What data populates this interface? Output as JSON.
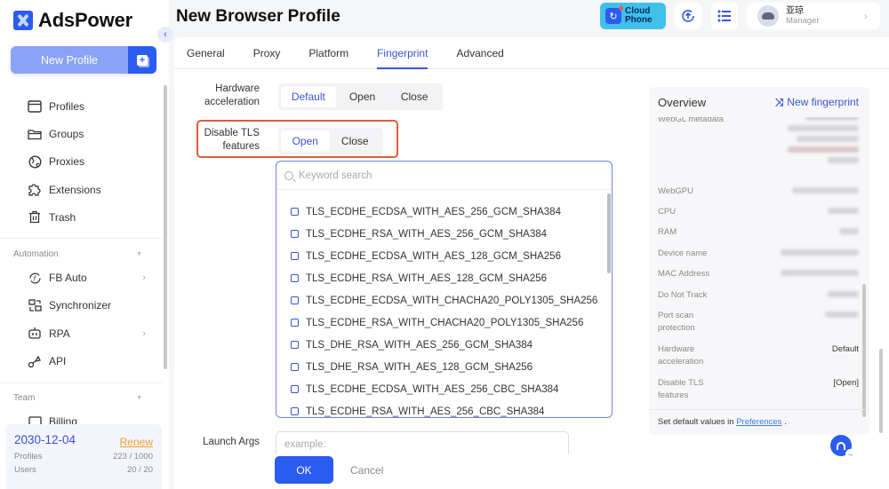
{
  "app": {
    "name": "AdsPower"
  },
  "sidebar": {
    "new_profile_label": "New Profile",
    "items": [
      {
        "label": "Profiles",
        "icon": "browser-window-icon"
      },
      {
        "label": "Groups",
        "icon": "folder-icon"
      },
      {
        "label": "Proxies",
        "icon": "globe-icon"
      },
      {
        "label": "Extensions",
        "icon": "puzzle-icon"
      },
      {
        "label": "Trash",
        "icon": "trash-icon"
      }
    ],
    "automation": {
      "title": "Automation",
      "items": [
        {
          "label": "FB Auto",
          "icon": "facebook-sync-icon",
          "has_submenu": true
        },
        {
          "label": "Synchronizer",
          "icon": "sync-devices-icon",
          "has_submenu": false
        },
        {
          "label": "RPA",
          "icon": "robot-icon",
          "has_submenu": true
        },
        {
          "label": "API",
          "icon": "plug-icon",
          "has_submenu": false
        }
      ]
    },
    "team": {
      "title": "Team",
      "items": [
        {
          "label": "Billing",
          "icon": "billing-icon"
        }
      ]
    },
    "plan": {
      "expiry": "2030-12-04",
      "renew_label": "Renew",
      "profiles_label": "Profiles",
      "profiles_value": "223 / 1000",
      "users_label": "Users",
      "users_value": "20 / 20"
    }
  },
  "header": {
    "title": "New Browser Profile",
    "cloud_phone_line1": "Cloud",
    "cloud_phone_line2": "Phone",
    "user_name": "亚琼",
    "user_role": "Manager"
  },
  "tabs": [
    {
      "label": "General",
      "active": false
    },
    {
      "label": "Proxy",
      "active": false
    },
    {
      "label": "Platform",
      "active": false
    },
    {
      "label": "Fingerprint",
      "active": true
    },
    {
      "label": "Advanced",
      "active": false
    }
  ],
  "form": {
    "hardware_acceleration": {
      "label_line1": "Hardware",
      "label_line2": "acceleration",
      "options": [
        "Default",
        "Open",
        "Close"
      ],
      "selected": "Default"
    },
    "disable_tls": {
      "label_line1": "Disable TLS",
      "label_line2": "features",
      "options": [
        "Open",
        "Close"
      ],
      "selected": "Open"
    },
    "tls_dropdown": {
      "search_placeholder": "Keyword search",
      "items": [
        "TLS_ECDHE_ECDSA_WITH_AES_256_GCM_SHA384",
        "TLS_ECDHE_RSA_WITH_AES_256_GCM_SHA384",
        "TLS_ECDHE_ECDSA_WITH_AES_128_GCM_SHA256",
        "TLS_ECDHE_RSA_WITH_AES_128_GCM_SHA256",
        "TLS_ECDHE_ECDSA_WITH_CHACHA20_POLY1305_SHA256",
        "TLS_ECDHE_RSA_WITH_CHACHA20_POLY1305_SHA256",
        "TLS_DHE_RSA_WITH_AES_256_GCM_SHA384",
        "TLS_DHE_RSA_WITH_AES_128_GCM_SHA256",
        "TLS_ECDHE_ECDSA_WITH_AES_256_CBC_SHA384",
        "TLS_ECDHE_RSA_WITH_AES_256_CBC_SHA384"
      ]
    },
    "launch_args": {
      "label": "Launch Args",
      "placeholder": "example:"
    },
    "ok_label": "OK",
    "cancel_label": "Cancel"
  },
  "overview": {
    "title": "Overview",
    "new_fingerprint_label": "New fingerprint",
    "rows": [
      {
        "label": "WebGL metadata",
        "value": ""
      },
      {
        "label": "WebGPU",
        "value": ""
      },
      {
        "label": "CPU",
        "value": ""
      },
      {
        "label": "RAM",
        "value": ""
      },
      {
        "label": "Device name",
        "value": ""
      },
      {
        "label": "MAC Address",
        "value": ""
      },
      {
        "label": "Do Not Track",
        "value": ""
      },
      {
        "label": "Port scan protection",
        "value": ""
      },
      {
        "label": "Hardware acceleration",
        "value": "Default"
      },
      {
        "label": "Disable TLS features",
        "value": "[Open]"
      }
    ],
    "footer_text": "Set default values in",
    "footer_link": "Preferences",
    "footer_end": "."
  }
}
